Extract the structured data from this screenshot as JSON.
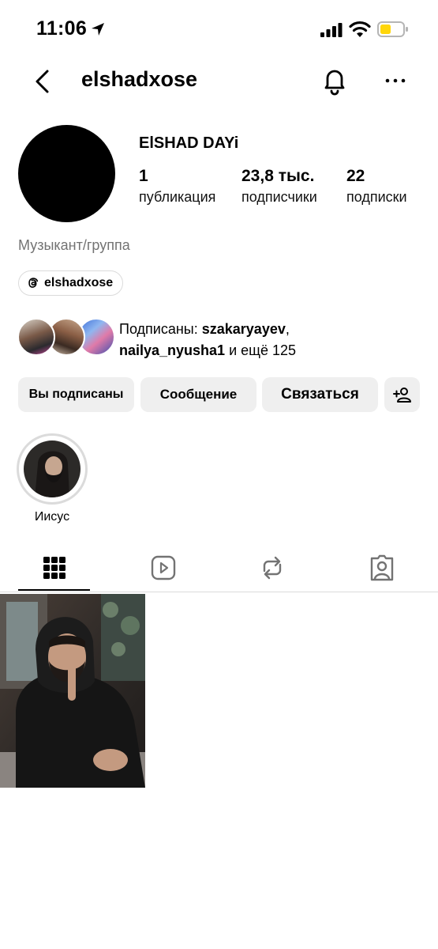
{
  "status_bar": {
    "time": "11:06"
  },
  "header": {
    "username": "elshadxose"
  },
  "profile": {
    "display_name": "ElSHAD DAYi",
    "stats": [
      {
        "value": "1",
        "label": "публикация"
      },
      {
        "value": "23,8 тыс.",
        "label": "подписчики"
      },
      {
        "value": "22",
        "label": "подписки"
      }
    ],
    "category": "Музыкант/группа",
    "threads_handle": "elshadxose"
  },
  "mutual": {
    "prefix": "Подписаны: ",
    "user1": "szakaryayev",
    "sep": ",",
    "user2": "nailya_nyusha1",
    "suffix": " и ещё 125"
  },
  "buttons": {
    "following": "Вы подписаны",
    "message": "Сообщение",
    "contact": "Связаться"
  },
  "highlights": [
    {
      "label": "Иисус"
    }
  ],
  "colors": {
    "button_bg": "#efefef",
    "secondary_text": "#737373",
    "battery": "#ffd60a"
  }
}
